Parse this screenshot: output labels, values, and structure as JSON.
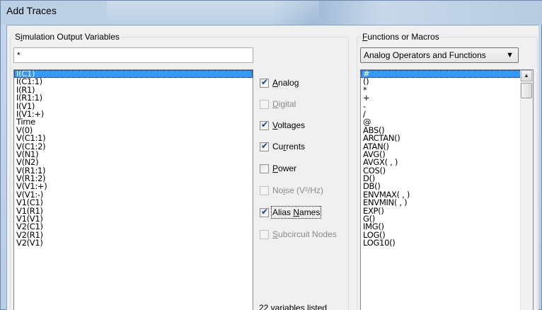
{
  "window": {
    "title": "Add Traces"
  },
  "output_vars": {
    "group_label": "Simulation Output Variables",
    "filter_value": "*",
    "items": [
      "I(C1)",
      "I(C1:1)",
      "I(R1)",
      "I(R1:1)",
      "I(V1)",
      "I(V1:+)",
      "Time",
      "V(0)",
      "V(C1:1)",
      "V(C1:2)",
      "V(N1)",
      "V(N2)",
      "V(R1:1)",
      "V(R1:2)",
      "V(V1:+)",
      "V(V1:-)",
      "V1(C1)",
      "V1(R1)",
      "V1(V1)",
      "V2(C1)",
      "V2(R1)",
      "V2(V1)"
    ],
    "selected_index": 0
  },
  "filters": [
    {
      "label": "Analog",
      "checked": true,
      "enabled": true
    },
    {
      "label": "Digital",
      "checked": false,
      "enabled": false
    },
    {
      "label": "Voltages",
      "checked": true,
      "enabled": true
    },
    {
      "label": "Currents",
      "checked": true,
      "enabled": true
    },
    {
      "label": "Power",
      "checked": false,
      "enabled": true
    },
    {
      "label": "Noise (V²/Hz)",
      "checked": false,
      "enabled": false
    },
    {
      "label": "Alias Names",
      "checked": true,
      "enabled": true
    },
    {
      "label": "Subcircuit Nodes",
      "checked": false,
      "enabled": false
    }
  ],
  "status": {
    "count_text": "22 variables listed"
  },
  "functions": {
    "group_label": "Functions or Macros",
    "dropdown_value": "Analog Operators and Functions",
    "items": [
      "#",
      "()",
      "*",
      "+",
      "-",
      "/",
      "@",
      "ABS()",
      "ARCTAN()",
      "ATAN()",
      "AVG()",
      "AVGX( , )",
      "COS()",
      "D()",
      "DB()",
      "ENVMAX( , )",
      "ENVMIN( , )",
      "EXP()",
      "G()",
      "IMG()",
      "LOG()",
      "LOG10()"
    ],
    "selected_index": 0
  }
}
